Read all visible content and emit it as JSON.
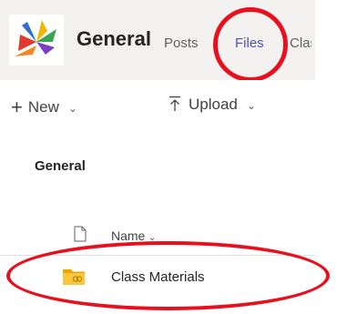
{
  "header": {
    "team_name": "General",
    "logo_icon": "teams-class-logo-icon",
    "tabs": [
      {
        "label": "Posts"
      },
      {
        "label": "Files"
      },
      {
        "label": "Class Notebook"
      }
    ],
    "active_tab_color": "#4f52b2"
  },
  "toolbar": {
    "new_label": "New",
    "upload_label": "Upload",
    "new_icon": "plus-icon",
    "upload_icon": "upload-icon",
    "chevron_icon": "chevron-down-icon"
  },
  "breadcrumb": {
    "title": "General"
  },
  "file_list": {
    "column_name_label": "Name",
    "column_icon": "document-icon",
    "rows": [
      {
        "name": "Class Materials",
        "icon": "shared-folder-icon"
      }
    ]
  },
  "annotations": {
    "color": "#e8101f"
  }
}
